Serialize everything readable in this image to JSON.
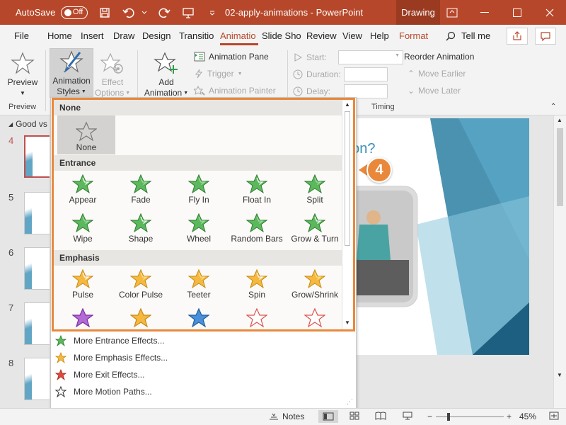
{
  "titlebar": {
    "autosave_label": "AutoSave",
    "autosave_state": "Off",
    "doc_title": "02-apply-animations  -  PowerPoint",
    "context_tab": "Drawing"
  },
  "tabs": {
    "file": "File",
    "home": "Home",
    "insert": "Insert",
    "draw": "Draw",
    "design": "Design",
    "transitions": "Transitio",
    "animations": "Animatio",
    "slideshow": "Slide Sho",
    "review": "Review",
    "view": "View",
    "help": "Help",
    "format": "Format",
    "tellme": "Tell me"
  },
  "ribbon": {
    "preview": "Preview",
    "preview_group": "Preview",
    "animation_styles_l1": "Animation",
    "animation_styles_l2": "Styles",
    "effect_options_l1": "Effect",
    "effect_options_l2": "Options",
    "add_animation_l1": "Add",
    "add_animation_l2": "Animation",
    "animation_pane": "Animation Pane",
    "trigger": "Trigger",
    "animation_painter": "Animation Painter",
    "start": "Start:",
    "duration": "Duration:",
    "delay": "Delay:",
    "reorder": "Reorder Animation",
    "move_earlier": "Move Earlier",
    "move_later": "Move Later",
    "timing_group": "Timing"
  },
  "slides": {
    "section": "Good vs",
    "numbers": [
      "4",
      "5",
      "6",
      "7",
      "8"
    ],
    "slide_title_fragment": "ation?"
  },
  "gallery": {
    "sections": {
      "none": "None",
      "entrance": "Entrance",
      "emphasis": "Emphasis"
    },
    "none_item": "None",
    "entrance": [
      "Appear",
      "Fade",
      "Fly In",
      "Float In",
      "Split",
      "Wipe",
      "Shape",
      "Wheel",
      "Random Bars",
      "Grow & Turn"
    ],
    "emphasis": [
      "Pulse",
      "Color Pulse",
      "Teeter",
      "Spin",
      "Grow/Shrink"
    ]
  },
  "more": {
    "entrance": "More Entrance Effects...",
    "emphasis": "More Emphasis Effects...",
    "exit": "More Exit Effects...",
    "motion": "More Motion Paths..."
  },
  "callout": "4",
  "status": {
    "notes": "Notes",
    "zoom": "45%"
  },
  "colors": {
    "accent": "#b7472a",
    "callout": "#e9883b",
    "entrance_star": "#5cb85c",
    "emphasis_star": "#f5b942"
  }
}
